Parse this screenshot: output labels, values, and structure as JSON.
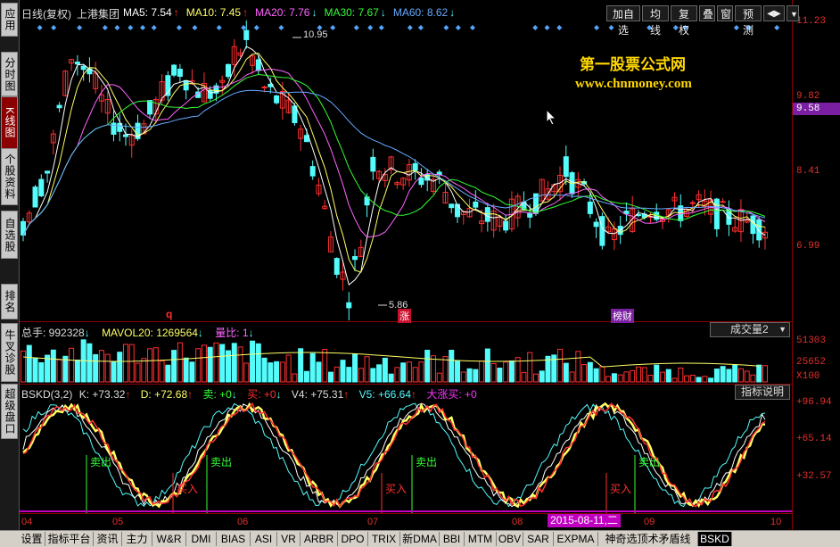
{
  "sidebar": {
    "items": [
      {
        "label": "应用",
        "active": false
      },
      {
        "label": "分时图",
        "active": false
      },
      {
        "label": "K线图",
        "active": true
      },
      {
        "label": "个股资料",
        "active": false
      },
      {
        "label": "自选股",
        "active": false
      },
      {
        "label": "排名",
        "active": false
      },
      {
        "label": "牛叉诊股",
        "active": false
      },
      {
        "label": "超级盘口",
        "active": false
      }
    ]
  },
  "main_header": {
    "chart_type": "日线(复权)",
    "stock_name": "上港集团",
    "ma": [
      {
        "label": "MA5: 7.54",
        "arrow": "↑",
        "color": "#ffffff"
      },
      {
        "label": "MA10: 7.45",
        "arrow": "↑",
        "color": "#ffff66"
      },
      {
        "label": "MA20: 7.76",
        "arrow": "↓",
        "color": "#ff66ff"
      },
      {
        "label": "MA30: 7.67",
        "arrow": "↓",
        "color": "#33ff33"
      },
      {
        "label": "MA60: 8.62",
        "arrow": "↓",
        "color": "#66aaff"
      }
    ]
  },
  "toolbar": {
    "buttons": [
      "加自选",
      "均线",
      "复权",
      "叠",
      "窗",
      "预测"
    ],
    "arrows": "◀▶",
    "menu": "▼"
  },
  "watermark": {
    "title": "第一股票公式网",
    "url": "www.chnmoney.com"
  },
  "price_axis": {
    "labels": [
      "11.23",
      "9.82",
      "8.41",
      "6.99"
    ],
    "current": "9.58"
  },
  "annotations": {
    "high": "10.95",
    "low": "5.86",
    "q_mark": "q",
    "zhang": "涨",
    "bangcai": "榜财"
  },
  "volume_header": {
    "total": "总手: 992328",
    "total_arrow": "↓",
    "mavol": "MAVOL20: 1269564",
    "mavol_arrow": "↓",
    "ratio": "量比: 1",
    "ratio_arrow": "↓",
    "dropdown": "成交量2"
  },
  "volume_axis": {
    "labels": [
      "51303",
      "25652",
      "X100"
    ]
  },
  "indicator_header": {
    "name": "BSKD(3,2)",
    "k": "K: +73.32",
    "k_arrow": "↑",
    "d": "D: +72.68",
    "d_arrow": "↑",
    "sell": "卖: +0",
    "sell_arrow": "↓",
    "buy": "买: +0",
    "buy_arrow": "↓",
    "v4": "V4: +75.31",
    "v4_arrow": "↑",
    "v5": "V5: +66.64",
    "v5_arrow": "↑",
    "big_rise": "大涨买: +0",
    "explain_btn": "指标说明"
  },
  "indicator_axis": {
    "labels": [
      "+96.94",
      "+65.14",
      "+32.57"
    ]
  },
  "signals": {
    "sell_label": "卖出",
    "buy_label": "买入",
    "sell_tag": "卖",
    "buy_tag": "买"
  },
  "date_axis": {
    "labels": [
      "04",
      "05",
      "06",
      "07",
      "08",
      "09",
      "10"
    ],
    "highlight": "2015-08-11,二"
  },
  "bottom_tabs": [
    "设置",
    "指标平台",
    "资讯",
    "主力",
    "W&R",
    "DMI",
    "BIAS",
    "ASI",
    "VR",
    "ARBR",
    "DPO",
    "TRIX",
    "新DMA",
    "BBI",
    "MTM",
    "OBV",
    "SAR",
    "EXPMA",
    "神奇选顶术矛盾线",
    "BSKD"
  ],
  "colors": {
    "up": "#ff3030",
    "down": "#54fcfc",
    "accent": "#8b0000"
  }
}
